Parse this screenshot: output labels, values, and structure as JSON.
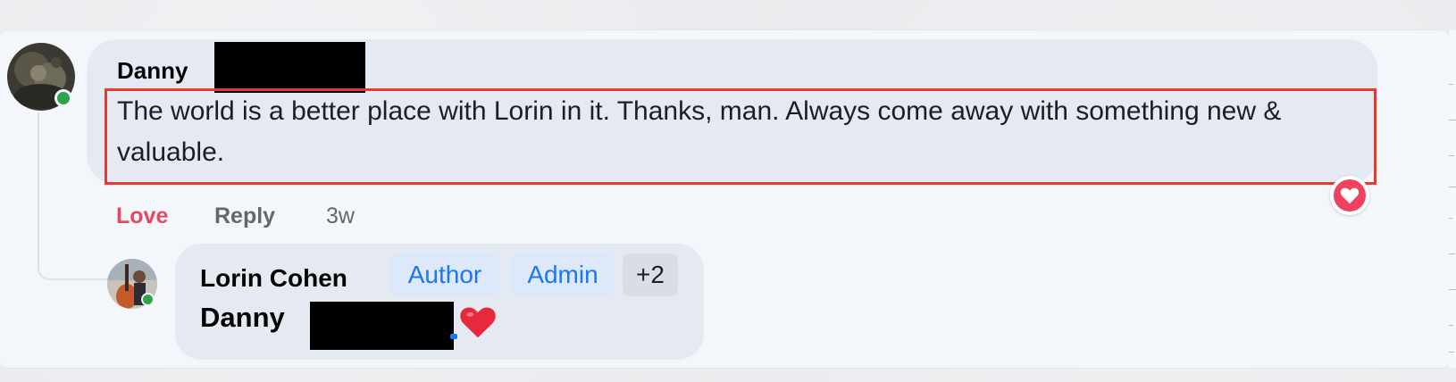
{
  "comment": {
    "author_first_name": "Danny",
    "text": "The world is a better place with Lorin in it. Thanks, man. Always come away with something new & valuable.",
    "actions": {
      "love_label": "Love",
      "reply_label": "Reply",
      "timestamp": "3w"
    },
    "reaction_icon": "heart-icon",
    "avatar_status": "online"
  },
  "reply": {
    "author_name": "Lorin Cohen",
    "badges": {
      "author": "Author",
      "admin": "Admin",
      "more": "+2"
    },
    "mention_first_name": "Danny",
    "emoji_icon": "red-heart-emoji",
    "avatar_status": "online"
  },
  "colors": {
    "love_accent": "#e8475f",
    "badge_text": "#1877f2",
    "highlight_border": "#e53b30",
    "online_dot": "#31a24c"
  }
}
